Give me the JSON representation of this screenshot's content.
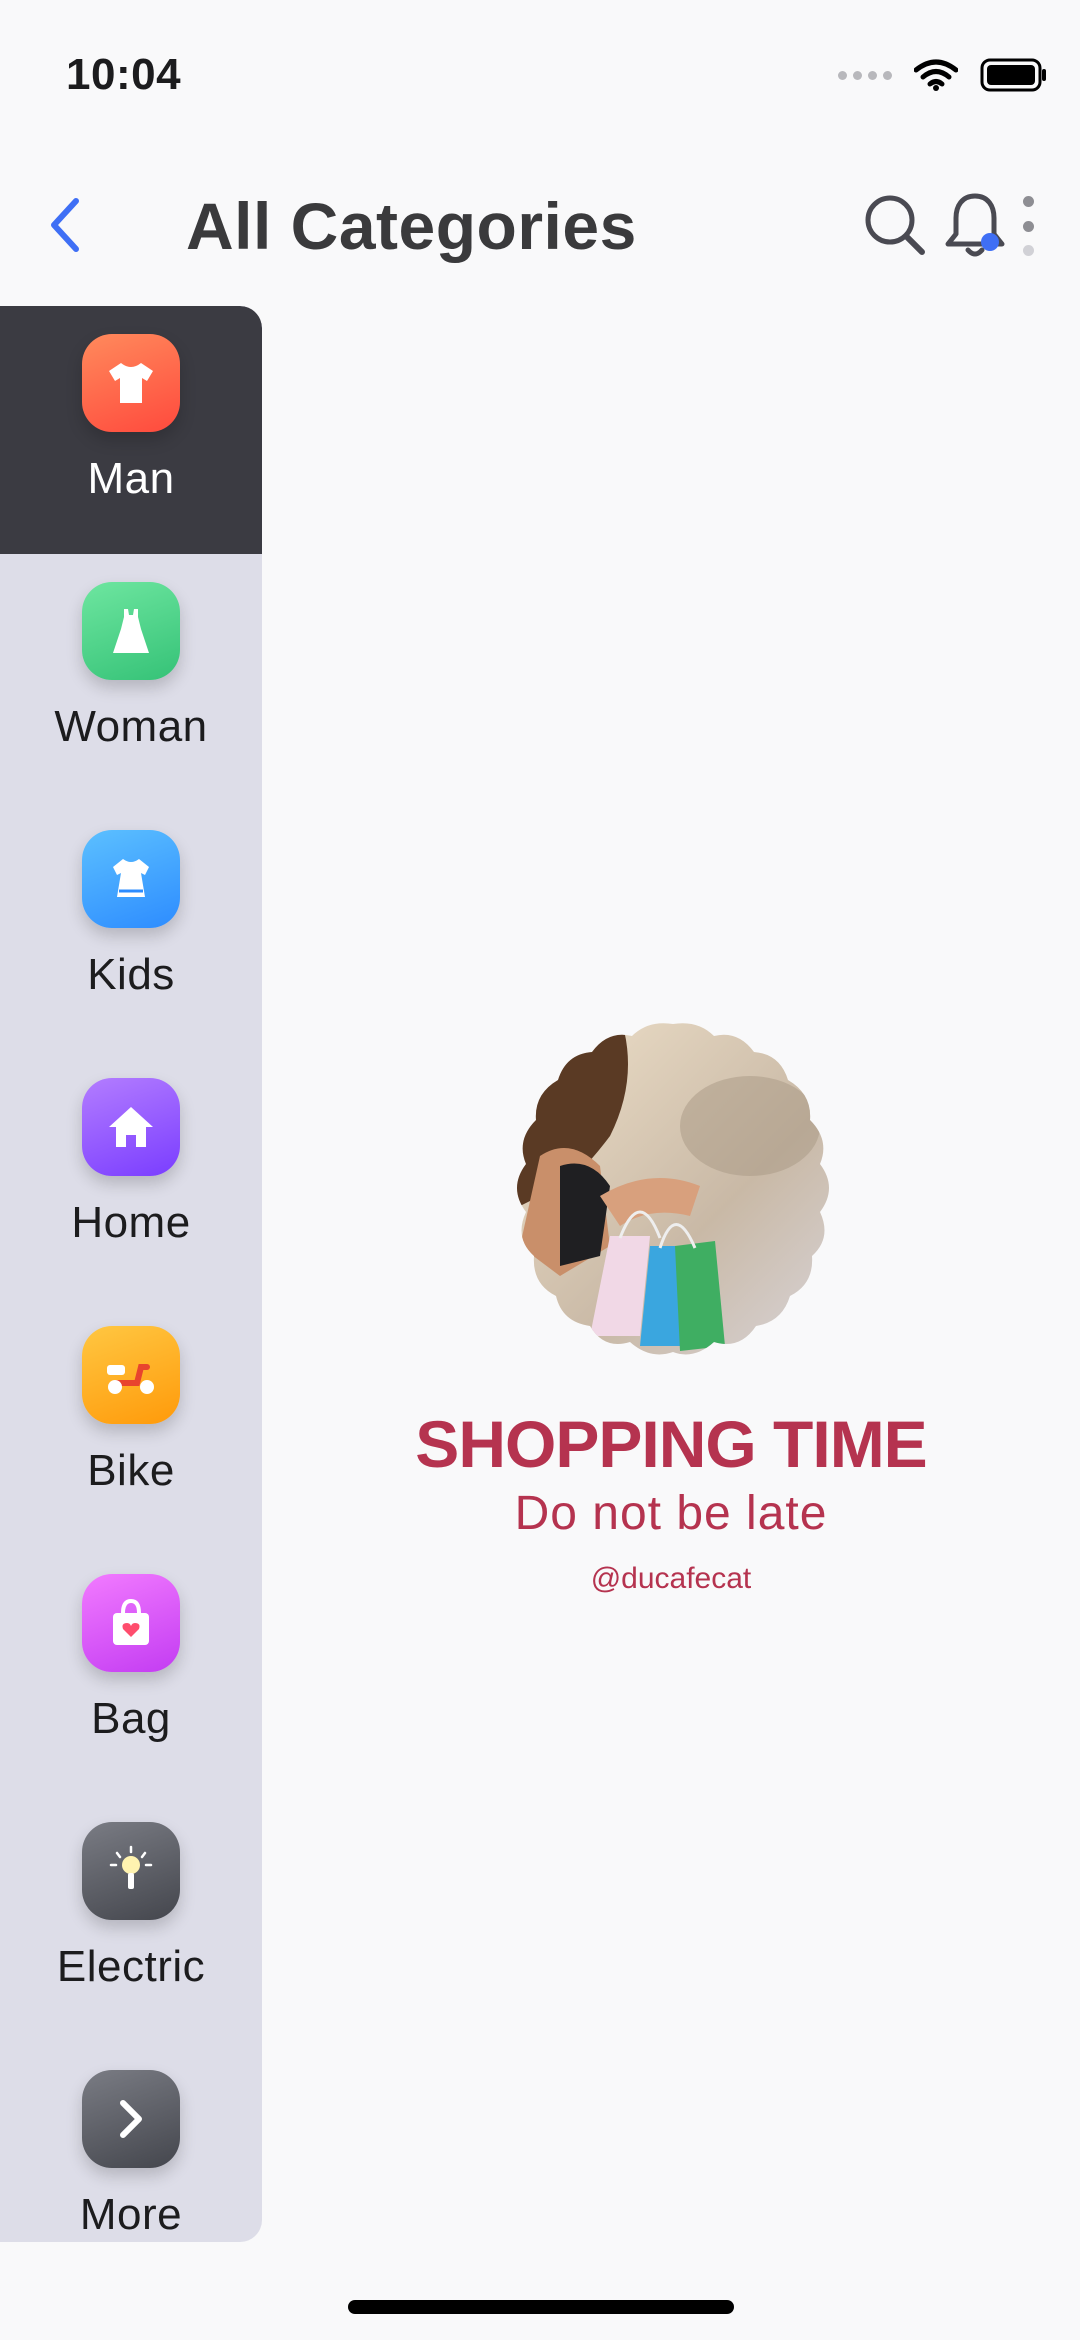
{
  "status_bar": {
    "time": "10:04"
  },
  "header": {
    "title": "All Categories"
  },
  "sidebar": {
    "items": [
      {
        "label": "Man",
        "icon": "tshirt-icon",
        "color": "#ff6a47",
        "active": true
      },
      {
        "label": "Woman",
        "icon": "dress-icon",
        "color": "#4fd68a"
      },
      {
        "label": "Kids",
        "icon": "kids-dress-icon",
        "color": "#3aa4ff"
      },
      {
        "label": "Home",
        "icon": "house-icon",
        "color": "#9b5cff"
      },
      {
        "label": "Bike",
        "icon": "scooter-icon",
        "color": "#ffb21e"
      },
      {
        "label": "Bag",
        "icon": "shopping-bag-icon",
        "color": "#e45bff"
      },
      {
        "label": "Electric",
        "icon": "light-bulb-icon",
        "color": "#5d5f66"
      },
      {
        "label": "More",
        "icon": "chevron-right-icon",
        "color": "#5d5f66"
      }
    ]
  },
  "promo": {
    "title": "SHOPPING TIME",
    "subtitle": "Do not be late",
    "handle": "@ducafecat"
  },
  "colors": {
    "accent": "#3f6ff5",
    "promo": "#b5334f",
    "sidebar_bg": "#dddde8",
    "active_bg": "#3b3b42"
  }
}
